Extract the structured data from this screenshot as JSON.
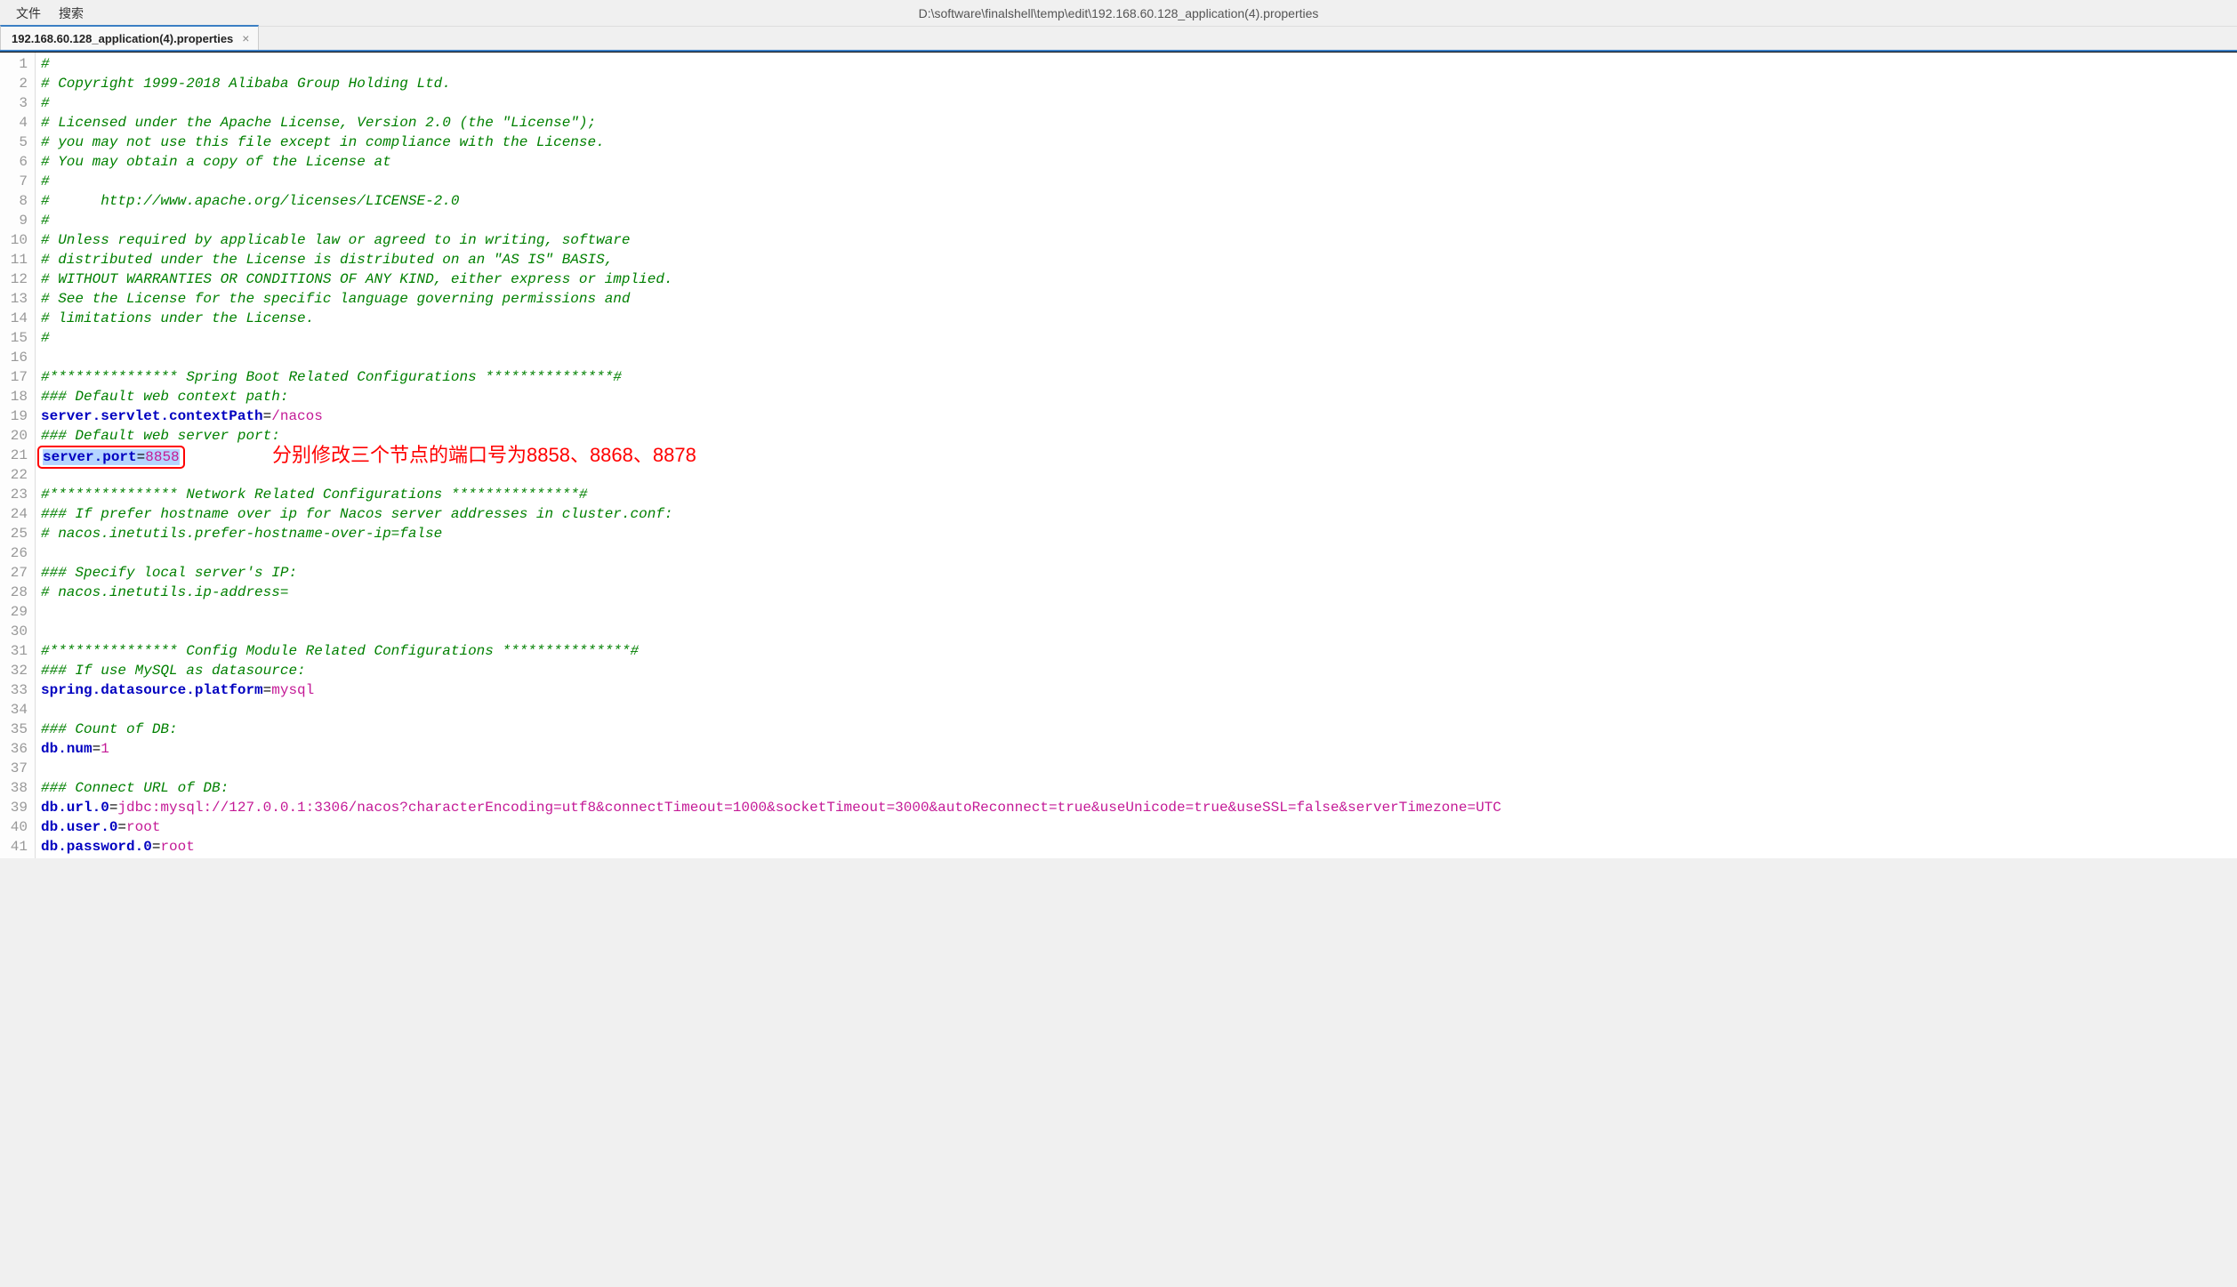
{
  "menu": {
    "file": "文件",
    "search": "搜索"
  },
  "title_path": "D:\\software\\finalshell\\temp\\edit\\192.168.60.128_application(4).properties",
  "tab": {
    "label": "192.168.60.128_application(4).properties",
    "close": "×"
  },
  "annotation": "分别修改三个节点的端口号为8858、8868、8878",
  "lines": {
    "l1": {
      "type": "comment",
      "text": "#"
    },
    "l2": {
      "type": "comment",
      "text": "# Copyright 1999-2018 Alibaba Group Holding Ltd."
    },
    "l3": {
      "type": "comment",
      "text": "#"
    },
    "l4": {
      "type": "comment",
      "text": "# Licensed under the Apache License, Version 2.0 (the \"License\");"
    },
    "l5": {
      "type": "comment",
      "text": "# you may not use this file except in compliance with the License."
    },
    "l6": {
      "type": "comment",
      "text": "# You may obtain a copy of the License at"
    },
    "l7": {
      "type": "comment",
      "text": "#"
    },
    "l8": {
      "type": "comment",
      "text": "#      http://www.apache.org/licenses/LICENSE-2.0"
    },
    "l9": {
      "type": "comment",
      "text": "#"
    },
    "l10": {
      "type": "comment",
      "text": "# Unless required by applicable law or agreed to in writing, software"
    },
    "l11": {
      "type": "comment",
      "text": "# distributed under the License is distributed on an \"AS IS\" BASIS,"
    },
    "l12": {
      "type": "comment",
      "text": "# WITHOUT WARRANTIES OR CONDITIONS OF ANY KIND, either express or implied."
    },
    "l13": {
      "type": "comment",
      "text": "# See the License for the specific language governing permissions and"
    },
    "l14": {
      "type": "comment",
      "text": "# limitations under the License."
    },
    "l15": {
      "type": "comment",
      "text": "#"
    },
    "l16": {
      "type": "blank",
      "text": ""
    },
    "l17": {
      "type": "comment",
      "text": "#*************** Spring Boot Related Configurations ***************#"
    },
    "l18": {
      "type": "comment",
      "text": "### Default web context path:"
    },
    "l19": {
      "type": "kv",
      "key": "server.servlet.contextPath",
      "val": "/nacos"
    },
    "l20": {
      "type": "comment",
      "text": "### Default web server port:"
    },
    "l21": {
      "type": "kv",
      "key": "server.port",
      "val": "8858",
      "highlight": true
    },
    "l22": {
      "type": "blank",
      "text": ""
    },
    "l23": {
      "type": "comment",
      "text": "#*************** Network Related Configurations ***************#"
    },
    "l24": {
      "type": "comment",
      "text": "### If prefer hostname over ip for Nacos server addresses in cluster.conf:"
    },
    "l25": {
      "type": "comment",
      "text": "# nacos.inetutils.prefer-hostname-over-ip=false"
    },
    "l26": {
      "type": "blank",
      "text": ""
    },
    "l27": {
      "type": "comment",
      "text": "### Specify local server's IP:"
    },
    "l28": {
      "type": "comment",
      "text": "# nacos.inetutils.ip-address="
    },
    "l29": {
      "type": "blank",
      "text": ""
    },
    "l30": {
      "type": "blank",
      "text": ""
    },
    "l31": {
      "type": "comment",
      "text": "#*************** Config Module Related Configurations ***************#"
    },
    "l32": {
      "type": "comment",
      "text": "### If use MySQL as datasource:"
    },
    "l33": {
      "type": "kv",
      "key": "spring.datasource.platform",
      "val": "mysql"
    },
    "l34": {
      "type": "blank",
      "text": ""
    },
    "l35": {
      "type": "comment",
      "text": "### Count of DB:"
    },
    "l36": {
      "type": "kv",
      "key": "db.num",
      "val": "1"
    },
    "l37": {
      "type": "blank",
      "text": ""
    },
    "l38": {
      "type": "comment",
      "text": "### Connect URL of DB:"
    },
    "l39": {
      "type": "kv",
      "key": "db.url.0",
      "val": "jdbc:mysql://127.0.0.1:3306/nacos?characterEncoding=utf8&connectTimeout=1000&socketTimeout=3000&autoReconnect=true&useUnicode=true&useSSL=false&serverTimezone=UTC"
    },
    "l40": {
      "type": "kv",
      "key": "db.user.0",
      "val": "root"
    },
    "l41": {
      "type": "kv",
      "key": "db.password.0",
      "val": "root"
    }
  },
  "line_count": 41
}
